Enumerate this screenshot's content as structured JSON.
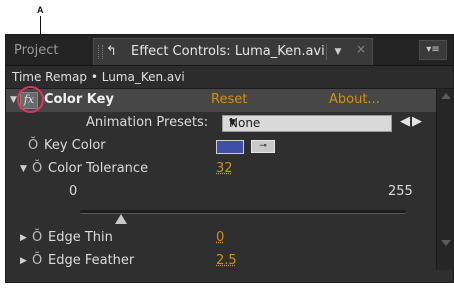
{
  "callout": {
    "letter": "A"
  },
  "tabs": {
    "project": "Project",
    "active_title": "Effect Controls: Luma_Ken.avi",
    "dropdown_glyph": "▼",
    "close_glyph": "×",
    "menu_glyph": "▾≡"
  },
  "subheader": {
    "text": "Time Remap • Luma_Ken.avi"
  },
  "effect": {
    "fx_label": "fx",
    "name": "Color Key",
    "reset": "Reset",
    "about": "About..."
  },
  "animation_presets": {
    "label": "Animation Presets:",
    "selected": "None",
    "caret": "▼",
    "nav": "◀▶"
  },
  "properties": {
    "key_color": {
      "label": "Key Color",
      "color": "#3f4ea6"
    },
    "color_tolerance": {
      "label": "Color Tolerance",
      "value": "32",
      "range_min": "0",
      "range_max": "255",
      "slider_value": 32
    },
    "edge_thin": {
      "label": "Edge Thin",
      "value": "0"
    },
    "edge_feather": {
      "label": "Edge Feather",
      "value": "2.5"
    }
  },
  "icons": {
    "twirl_open": "▼",
    "twirl_closed": "▶",
    "stopwatch": "Ŏ",
    "eyedropper": "⊸",
    "lock": "↰"
  },
  "colors": {
    "value_orange": "#d4910c",
    "callout_circle": "#e0355f",
    "panel_bg": "#2f2f2f"
  }
}
